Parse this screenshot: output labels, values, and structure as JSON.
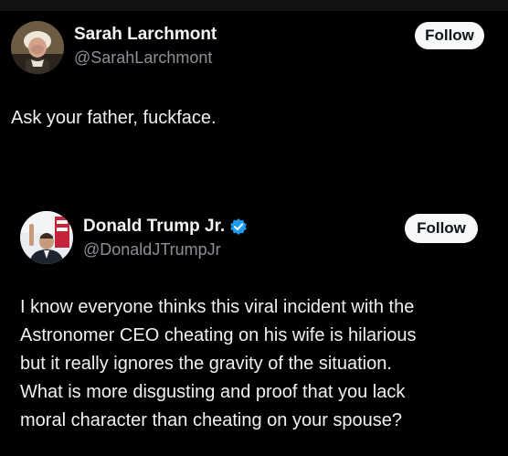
{
  "top_post": {
    "author_name": "Sarah Larchmont",
    "author_handle": "@SarahLarchmont",
    "follow_label": "Follow",
    "text": "Ask your father, fuckface."
  },
  "quoted_post": {
    "author_name": "Donald Trump Jr.",
    "author_handle": "@DonaldJTrumpJr",
    "follow_label": "Follow",
    "verified_color": "#1d9bf0",
    "text_lines": [
      "I know everyone thinks this viral incident with the",
      "Astronomer CEO cheating on his wife is hilarious",
      "but it really ignores the gravity of the situation.",
      "What is more disgusting and proof that you lack",
      "moral character than cheating on your spouse?"
    ]
  },
  "icons": {
    "verified": "verified-badge-icon"
  }
}
